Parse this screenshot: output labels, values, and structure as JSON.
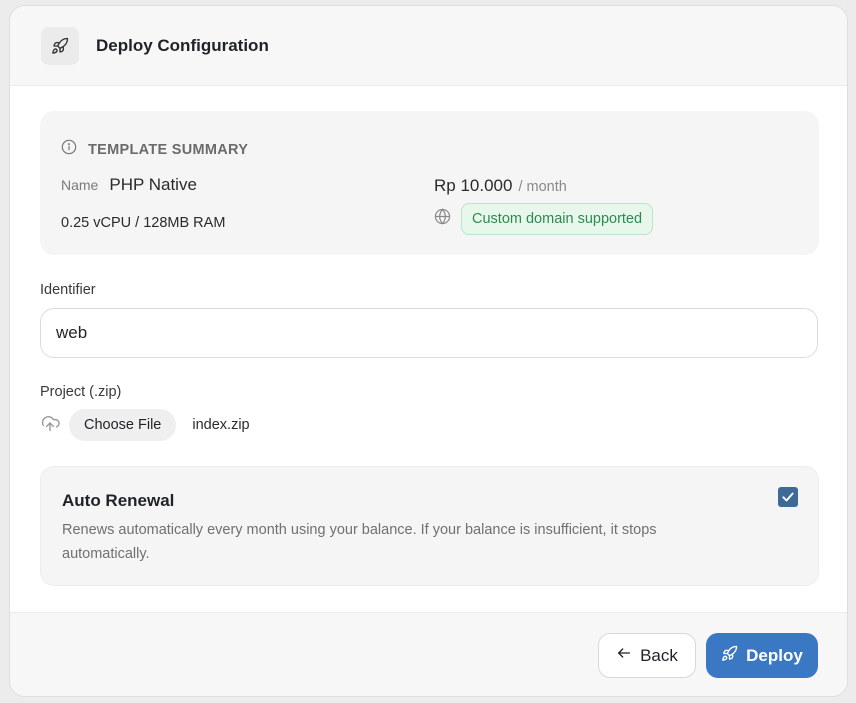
{
  "header": {
    "title": "Deploy Configuration",
    "icon": "rocket-icon"
  },
  "summary": {
    "heading": "TEMPLATE SUMMARY",
    "name_label": "Name",
    "name_value": "PHP Native",
    "specs": "0.25 vCPU / 128MB RAM",
    "price": "Rp 10.000",
    "price_period": "/ month",
    "domain_badge": "Custom domain supported"
  },
  "identifier": {
    "label": "Identifier",
    "value": "web",
    "placeholder": ""
  },
  "project": {
    "label": "Project (.zip)",
    "choose_label": "Choose File",
    "file_name": "index.zip"
  },
  "renewal": {
    "title": "Auto Renewal",
    "description": "Renews automatically every month using your balance. If your balance is insufficient, it stops automatically.",
    "checked": true
  },
  "footer": {
    "back_label": "Back",
    "deploy_label": "Deploy"
  },
  "colors": {
    "primary": "#3a78c4",
    "success_bg": "#e7f7ec",
    "success_text": "#2f8a4e",
    "checkbox": "#3e6a98"
  }
}
